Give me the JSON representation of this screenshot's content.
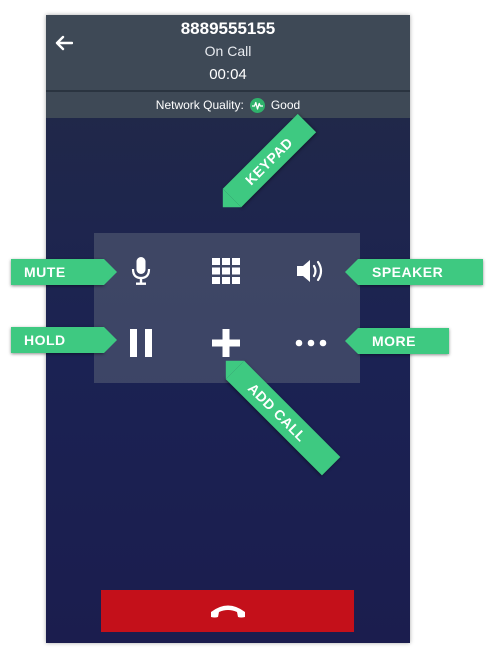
{
  "header": {
    "phone_number": "8889555155",
    "status": "On Call",
    "timer": "00:04",
    "back_icon": "arrow-left-icon"
  },
  "network": {
    "label": "Network Quality:",
    "value": "Good",
    "icon": "signal-wave-icon",
    "color": "#2fb26b"
  },
  "controls": [
    {
      "id": "mute",
      "icon": "microphone-icon"
    },
    {
      "id": "keypad",
      "icon": "keypad-grid-icon"
    },
    {
      "id": "speaker",
      "icon": "speaker-icon"
    },
    {
      "id": "hold",
      "icon": "pause-icon"
    },
    {
      "id": "add-call",
      "icon": "plus-icon"
    },
    {
      "id": "more",
      "icon": "more-dots-icon"
    }
  ],
  "end_call": {
    "icon": "phone-hangup-icon",
    "color": "#c4101a"
  },
  "callouts": {
    "mute": "MUTE",
    "hold": "HOLD",
    "keypad": "KEYPAD",
    "speaker": "SPEAKER",
    "more": "MORE",
    "add_call": "ADD CALL",
    "color": "#3ec981"
  }
}
